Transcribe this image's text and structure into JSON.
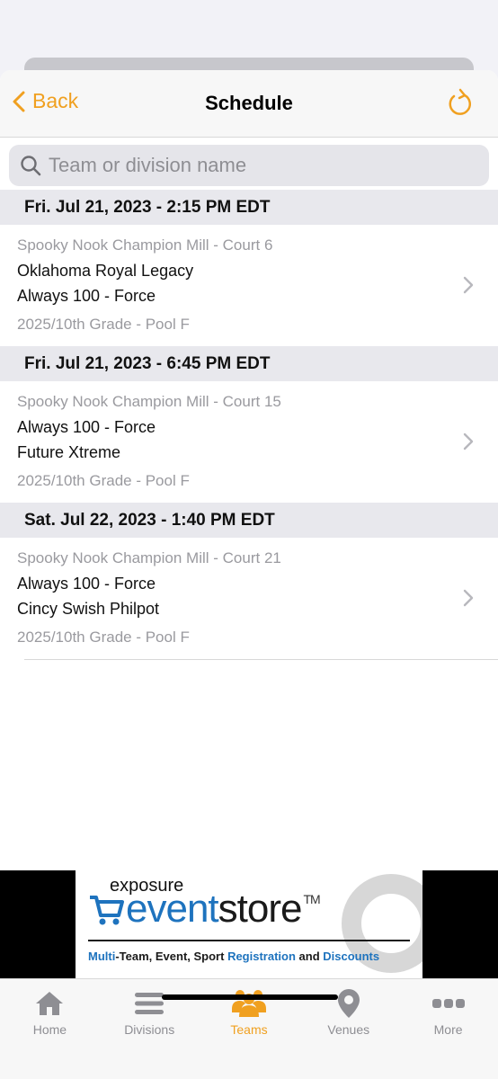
{
  "nav": {
    "back_label": "Back",
    "title": "Schedule"
  },
  "search": {
    "placeholder": "Team or division name"
  },
  "sections": [
    {
      "header": "Fri. Jul 21, 2023 - 2:15 PM EDT",
      "game": {
        "venue": "Spooky Nook Champion Mill - Court 6",
        "team1": "Oklahoma Royal Legacy",
        "team2": "Always 100 - Force",
        "division": "2025/10th Grade - Pool F"
      }
    },
    {
      "header": "Fri. Jul 21, 2023 - 6:45 PM EDT",
      "game": {
        "venue": "Spooky Nook Champion Mill - Court 15",
        "team1": "Always 100 - Force",
        "team2": "Future Xtreme",
        "division": "2025/10th Grade - Pool F"
      }
    },
    {
      "header": "Sat. Jul 22, 2023 - 1:40 PM EDT",
      "game": {
        "venue": "Spooky Nook Champion Mill - Court 21",
        "team1": "Always 100 - Force",
        "team2": "Cincy Swish Philpot",
        "division": "2025/10th Grade - Pool F"
      }
    }
  ],
  "ad": {
    "exposure": "exposure",
    "event": "event",
    "store": "store",
    "tm": "TM",
    "tagline_1": "Multi",
    "tagline_2": "-Team, Event, Sport ",
    "tagline_3": "Registration",
    "tagline_4": " and ",
    "tagline_5": "Discounts"
  },
  "tabs": [
    {
      "label": "Home",
      "icon": "house-icon"
    },
    {
      "label": "Divisions",
      "icon": "list-icon"
    },
    {
      "label": "Teams",
      "icon": "people-icon",
      "active": true
    },
    {
      "label": "Venues",
      "icon": "map-pin-icon"
    },
    {
      "label": "More",
      "icon": "ellipsis-icon"
    }
  ],
  "colors": {
    "accent": "#f0a020",
    "inactive": "#8e8e93",
    "brand_blue": "#1e73be"
  }
}
